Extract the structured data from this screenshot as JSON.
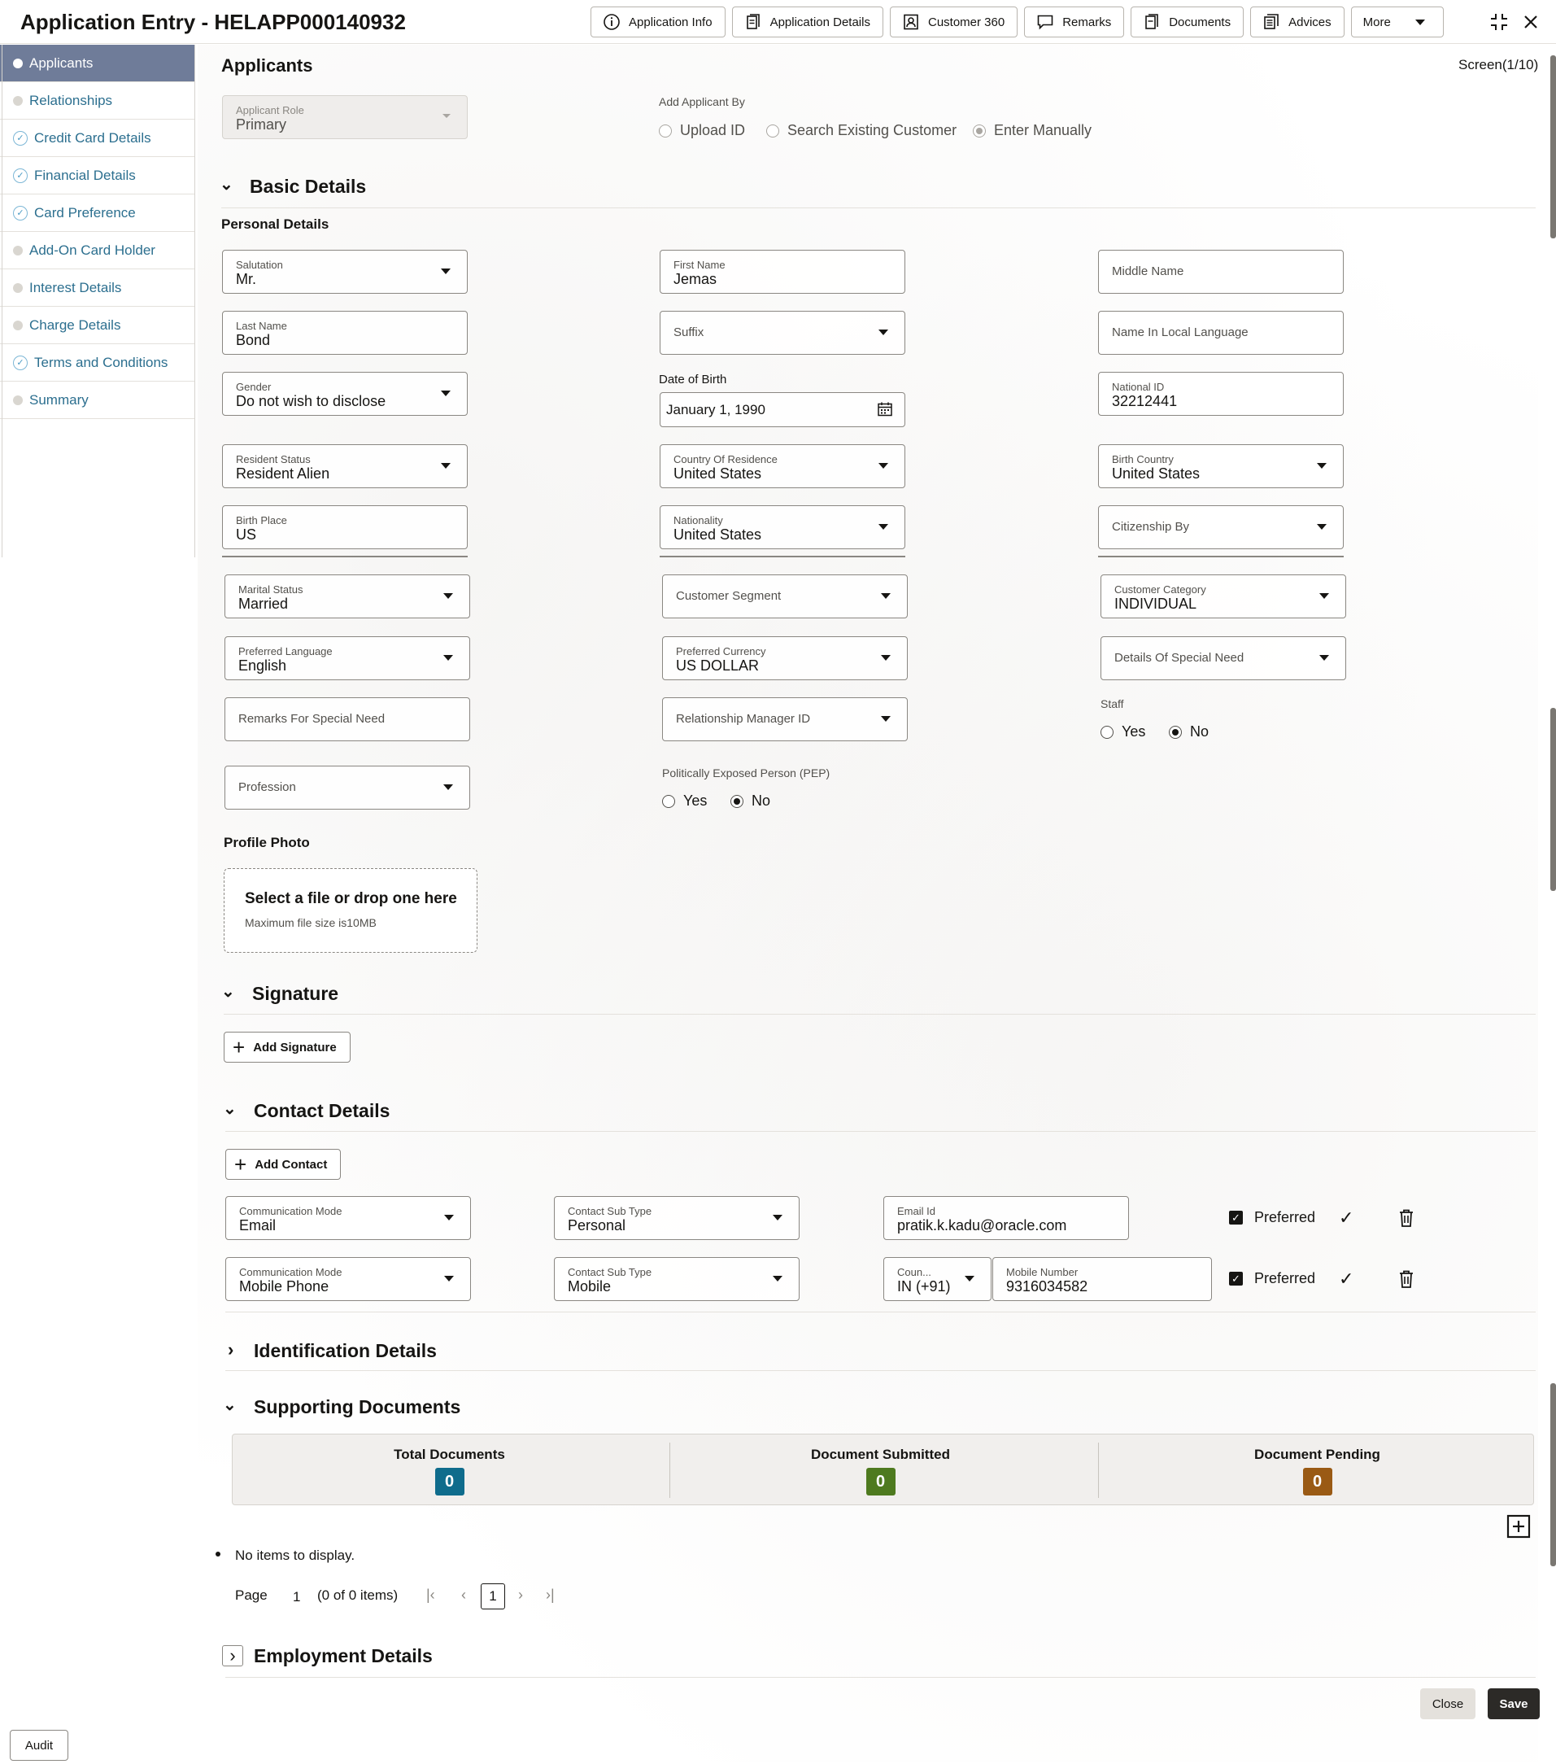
{
  "header": {
    "title": "Application Entry - HELAPP000140932",
    "buttons": [
      "Application Info",
      "Application Details",
      "Customer 360",
      "Remarks",
      "Documents",
      "Advices",
      "More"
    ]
  },
  "sidebar": {
    "items": [
      {
        "label": "Applicants",
        "state": "active"
      },
      {
        "label": "Relationships",
        "state": "pending"
      },
      {
        "label": "Credit Card Details",
        "state": "done"
      },
      {
        "label": "Financial Details",
        "state": "done"
      },
      {
        "label": "Card Preference",
        "state": "done"
      },
      {
        "label": "Add-On Card Holder",
        "state": "pending"
      },
      {
        "label": "Interest Details",
        "state": "pending"
      },
      {
        "label": "Charge Details",
        "state": "pending"
      },
      {
        "label": "Terms and Conditions",
        "state": "done"
      },
      {
        "label": "Summary",
        "state": "pending"
      }
    ]
  },
  "page": {
    "title": "Applicants",
    "screen": "Screen(1/10)",
    "applicant_role": {
      "label": "Applicant Role",
      "value": "Primary"
    },
    "add_by": {
      "label": "Add Applicant By",
      "options": [
        "Upload ID",
        "Search Existing Customer",
        "Enter Manually"
      ],
      "selected": "Enter Manually"
    }
  },
  "basic": {
    "title": "Basic Details",
    "personal_title": "Personal Details",
    "salutation": {
      "label": "Salutation",
      "value": "Mr."
    },
    "first_name": {
      "label": "First Name",
      "value": "Jemas"
    },
    "middle_name": {
      "placeholder": "Middle Name"
    },
    "last_name": {
      "label": "Last Name",
      "value": "Bond"
    },
    "suffix": {
      "placeholder": "Suffix"
    },
    "local_name": {
      "placeholder": "Name In Local Language"
    },
    "gender": {
      "label": "Gender",
      "value": "Do not wish to disclose"
    },
    "dob": {
      "label": "Date of Birth",
      "value": "January 1, 1990"
    },
    "national_id": {
      "label": "National ID",
      "value": "32212441"
    },
    "resident_status": {
      "label": "Resident Status",
      "value": "Resident Alien"
    },
    "country_residence": {
      "label": "Country Of Residence",
      "value": "United States"
    },
    "birth_country": {
      "label": "Birth Country",
      "value": "United States"
    },
    "birth_place": {
      "label": "Birth Place",
      "value": "US"
    },
    "nationality": {
      "label": "Nationality",
      "value": "United States"
    },
    "citizenship": {
      "placeholder": "Citizenship By"
    },
    "marital": {
      "label": "Marital Status",
      "value": "Married"
    },
    "segment": {
      "placeholder": "Customer Segment"
    },
    "category": {
      "label": "Customer Category",
      "value": "INDIVIDUAL"
    },
    "language": {
      "label": "Preferred Language",
      "value": "English"
    },
    "currency": {
      "label": "Preferred Currency",
      "value": "US DOLLAR"
    },
    "special_need": {
      "placeholder": "Details Of Special Need"
    },
    "remarks_special": {
      "placeholder": "Remarks For Special Need"
    },
    "rm_id": {
      "placeholder": "Relationship Manager ID"
    },
    "staff": {
      "label": "Staff",
      "options": [
        "Yes",
        "No"
      ],
      "selected": "No"
    },
    "profession": {
      "placeholder": "Profession"
    },
    "pep": {
      "label": "Politically Exposed Person (PEP)",
      "options": [
        "Yes",
        "No"
      ],
      "selected": "No"
    },
    "profile_photo": {
      "title": "Profile Photo",
      "drop_title": "Select a file or drop one here",
      "drop_sub": "Maximum file size is10MB"
    }
  },
  "signature": {
    "title": "Signature",
    "add_label": "Add Signature"
  },
  "contact": {
    "title": "Contact Details",
    "add_label": "Add Contact",
    "rows": [
      {
        "mode_label": "Communication Mode",
        "mode": "Email",
        "sub_label": "Contact Sub Type",
        "sub": "Personal",
        "value_label": "Email Id",
        "value": "pratik.k.kadu@oracle.com",
        "preferred": "Preferred"
      },
      {
        "mode_label": "Communication Mode",
        "mode": "Mobile Phone",
        "sub_label": "Contact Sub Type",
        "sub": "Mobile",
        "code_label": "Coun...",
        "code": "IN (+91)",
        "value_label": "Mobile Number",
        "value": "9316034582",
        "preferred": "Preferred"
      }
    ]
  },
  "identification": {
    "title": "Identification Details"
  },
  "supporting": {
    "title": "Supporting Documents",
    "stats": [
      {
        "label": "Total Documents",
        "value": "0",
        "color": "#0f6c8c"
      },
      {
        "label": "Document Submitted",
        "value": "0",
        "color": "#4e7a1f"
      },
      {
        "label": "Document Pending",
        "value": "0",
        "color": "#9a5a14"
      }
    ],
    "empty": "No items to display.",
    "pager": {
      "page_label": "Page",
      "page_value": "1",
      "items": "(0 of 0 items)",
      "current": "1"
    }
  },
  "employment": {
    "title": "Employment Details"
  },
  "footer": {
    "close": "Close",
    "save": "Save",
    "audit": "Audit"
  }
}
